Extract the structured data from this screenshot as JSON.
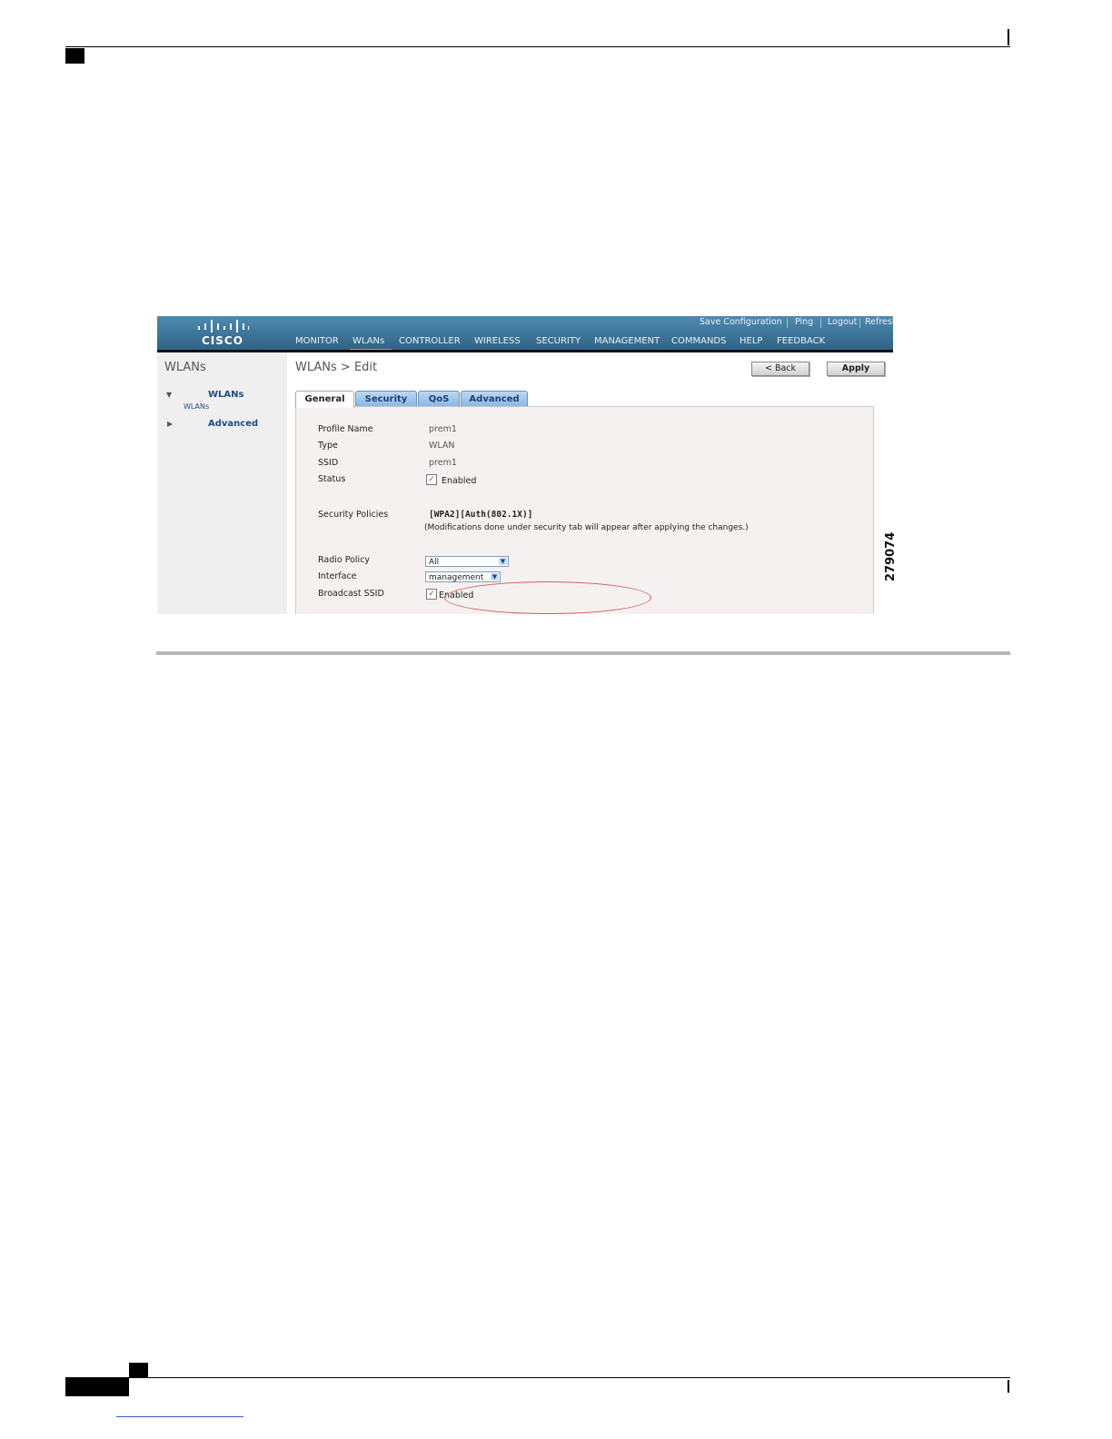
{
  "header": {
    "utility_links": [
      "Save Configuration",
      "Ping",
      "Logout",
      "Refresh"
    ],
    "logo_text": "CISCO",
    "nav": [
      "MONITOR",
      "WLANs",
      "CONTROLLER",
      "WIRELESS",
      "SECURITY",
      "MANAGEMENT",
      "COMMANDS",
      "HELP",
      "FEEDBACK"
    ],
    "active_nav": "WLANs",
    "colors": {
      "bar": "#3a7399",
      "active_indicator": "#e4961f",
      "tab_inactive": "#9cc2e8"
    }
  },
  "sidebar": {
    "title": "WLANs",
    "items": [
      {
        "label": "WLANs",
        "sub": "WLANs",
        "expanded": true
      },
      {
        "label": "Advanced",
        "expanded": false
      }
    ]
  },
  "main": {
    "title": "WLANs > Edit",
    "buttons": {
      "back": "< Back",
      "apply": "Apply"
    },
    "tabs": [
      "General",
      "Security",
      "QoS",
      "Advanced"
    ],
    "active_tab": "General",
    "form": {
      "profile_name": {
        "label": "Profile Name",
        "value": "prem1"
      },
      "type": {
        "label": "Type",
        "value": "WLAN"
      },
      "ssid": {
        "label": "SSID",
        "value": "prem1"
      },
      "status": {
        "label": "Status",
        "checked": true,
        "text": "Enabled"
      },
      "security_policies": {
        "label": "Security Policies",
        "value": "[WPA2][Auth(802.1X)]",
        "note": "(Modifications done under security tab will appear after applying the changes.)"
      },
      "radio_policy": {
        "label": "Radio Policy",
        "value": "All"
      },
      "interface": {
        "label": "Interface",
        "value": "management"
      },
      "broadcast_ssid": {
        "label": "Broadcast SSID",
        "checked": true,
        "text": "Enabled"
      }
    }
  },
  "figure_id": "279074"
}
